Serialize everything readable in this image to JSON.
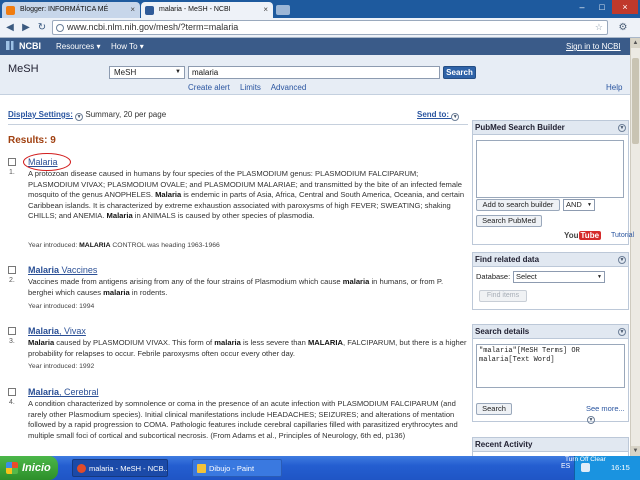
{
  "browser": {
    "tabs": [
      {
        "label": "Blogger: INFORMÁTICA MÉ"
      },
      {
        "label": "malaria - MeSH - NCBI"
      }
    ],
    "url": "www.ncbi.nlm.nih.gov/mesh/?term=malaria",
    "icons": {
      "back": "back-arrow-icon",
      "forward": "forward-arrow-icon",
      "reload": "reload-icon",
      "bookmark": "star-icon",
      "menu": "wrench-icon"
    }
  },
  "ncbi": {
    "logo": "NCBI",
    "resources": "Resources",
    "howto": "How To",
    "signin": "Sign in to NCBI",
    "arrow": "▾"
  },
  "search": {
    "db_title": "MeSH",
    "db_selected": "MeSH",
    "term": "malaria",
    "button": "Search",
    "links": [
      "Create alert",
      "Limits",
      "Advanced"
    ],
    "help": "Help"
  },
  "display": {
    "settings_label": "Display Settings:",
    "settings_value": "Summary, 20 per page",
    "send_to": "Send to:",
    "results": "Results: 9"
  },
  "results": [
    {
      "num": "1.",
      "title": "Malaria",
      "title_suffix": "",
      "desc_html": "A protozoan disease caused in humans by four species of the PLASMODIUM genus: PLASMODIUM FALCIPARUM; PLASMODIUM VIVAX; PLASMODIUM OVALE; and PLASMODIUM MALARIAE; and transmitted by the bite of an infected female mosquito of the genus ANOPHELES. Malaria is endemic in parts of Asia, Africa, Central and South America, Oceania, and certain Caribbean islands. It is characterized by extreme exhaustion associated with paroxysms of high FEVER; SWEATING; shaking CHILLS; and ANEMIA. Malaria in ANIMALS is caused by other species of plasmodia.",
      "year": "Year introduced: MALARIA CONTROL was heading 1963-1966"
    },
    {
      "num": "2.",
      "title": "Malaria",
      "title_suffix": " Vaccines",
      "desc_html": "Vaccines made from antigens arising from any of the four strains of Plasmodium which cause malaria in humans, or from P. berghei which causes malaria in rodents.",
      "year": "Year introduced: 1994"
    },
    {
      "num": "3.",
      "title": "Malaria",
      "title_suffix": ", Vivax",
      "desc_html": "Malaria caused by PLASMODIUM VIVAX. This form of malaria is less severe than MALARIA, FALCIPARUM, but there is a higher probability for relapses to occur. Febrile paroxysms often occur every other day.",
      "year": "Year introduced: 1992"
    },
    {
      "num": "4.",
      "title": "Malaria",
      "title_suffix": ", Cerebral",
      "desc_html": "A condition characterized by somnolence or coma in the presence of an acute infection with PLASMODIUM FALCIPARUM (and rarely other Plasmodium species). Initial clinical manifestations include HEADACHES; SEIZURES; and alterations of mentation followed by a rapid progression to COMA. Pathologic features include cerebral capillaries filled with parasitized erythrocytes and multiple small foci of cortical and subcortical necrosis. (From Adams et al., Principles of Neurology, 6th ed, p136)",
      "year": ""
    }
  ],
  "sidebar": {
    "builder": {
      "title": "PubMed Search Builder",
      "add_button": "Add to search builder",
      "operator": "AND",
      "search_button": "Search PubMed",
      "youtube_you": "You",
      "youtube_tube": "Tube",
      "tutorial": "Tutorial"
    },
    "related": {
      "title": "Find related data",
      "db_label": "Database:",
      "db_value": "Select",
      "find_button": "Find items"
    },
    "details": {
      "title": "Search details",
      "query": "\"malaria\"[MeSH Terms] OR\nmalaria[Text Word]",
      "search_button": "Search",
      "see_more": "See more..."
    },
    "recent": {
      "title": "Recent Activity",
      "turn_off": "Turn Off",
      "clear": "Clear"
    }
  },
  "taskbar": {
    "start": "Inicio",
    "windows": [
      {
        "label": "malaria - MeSH - NCB..."
      },
      {
        "label": "Dibujo - Paint"
      }
    ],
    "lang": "ES",
    "time": "16:15"
  }
}
